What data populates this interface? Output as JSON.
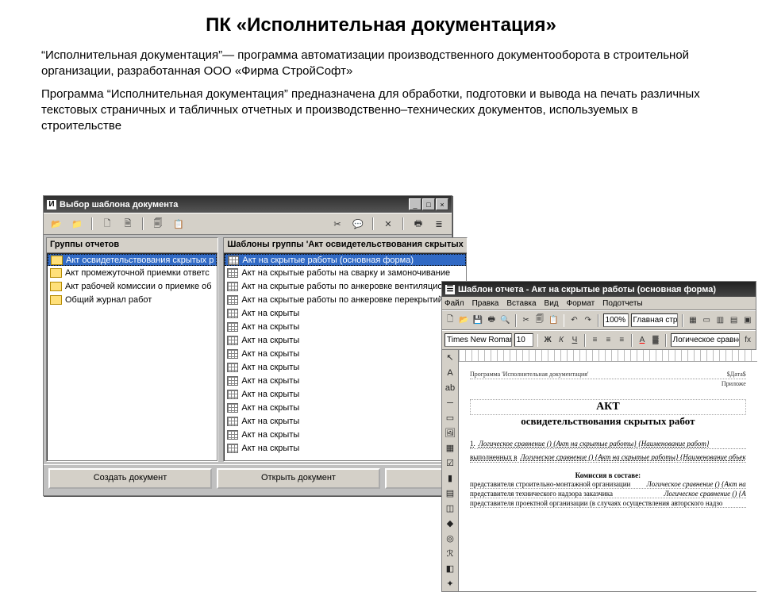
{
  "page": {
    "title": "ПК «Исполнительная документация»",
    "p1": "“Исполнительная документация”— программа автоматизации производственного документооборота в строительной организации, разработанная ООО «Фирма СтройСофт»",
    "p2": "Программа “Исполнительная документация” предназначена для обработки, подготовки и вывода на печать различных текстовых страничных и табличных отчетных и производственно–технических документов, используемых в строительстве"
  },
  "win1": {
    "title": "Выбор шаблона документа",
    "groups_header": "Группы отчетов",
    "templates_header": "Шаблоны группы 'Акт освидетельствования скрытых",
    "groups": [
      "Акт освидетельствования скрытых р",
      "Акт промежуточной приемки ответс",
      "Акт рабочей комиссии о приемке об",
      "Общий журнал работ"
    ],
    "templates": [
      "Акт на скрытые работы (основная форма)",
      "Акт на скрытые работы на сварку и замоночивание",
      "Акт на скрытые работы по анкеровке вентиляционн",
      "Акт на скрытые работы по анкеровке перекрытий",
      "Акт на скрыты",
      "Акт на скрыты",
      "Акт на скрыты",
      "Акт на скрыты",
      "Акт на скрыты",
      "Акт на скрыты",
      "Акт на скрыты",
      "Акт на скрыты",
      "Акт на скрыты",
      "Акт на скрыты",
      "Акт на скрыты"
    ],
    "btn_create": "Создать документ",
    "btn_open": "Открыть документ",
    "btn_close": " "
  },
  "win2": {
    "title": "Шаблон отчета - Акт на скрытые работы (основная форма)",
    "menus": [
      "Файл",
      "Правка",
      "Вставка",
      "Вид",
      "Формат",
      "Подотчеты"
    ],
    "scale": "100%",
    "page_label": "Главная стра",
    "font_name": "Times New Roman Cyr",
    "font_size": "10",
    "toc_combo": "Логическое сравнение ()",
    "doc": {
      "header_left": "Программа 'Исполнительная документация'",
      "header_right": "$Дата$",
      "attach_right": "Приложе",
      "act": "АКТ",
      "subtitle": "освидетельствования скрытых работ",
      "f1_label": "1.",
      "f1": "Логическое сравнение () {Акт на скрытые работы} {Наименование работ}",
      "f2_label": "выполненных в",
      "f2": "Логическое сравнение () {Акт на скрытые работы} {Наименование объек",
      "commission_title": "Комиссия в составе:",
      "c1_left": "представителя строительно-монтажной организации",
      "c1_right": "Логическое сравнение () {Акт на",
      "c2_left": "представителя технического надзора заказчика",
      "c2_right": "Логическое сравнение () {А",
      "c3_left": "представителя проектной организации (в случаях осуществления авторского надзо"
    }
  }
}
